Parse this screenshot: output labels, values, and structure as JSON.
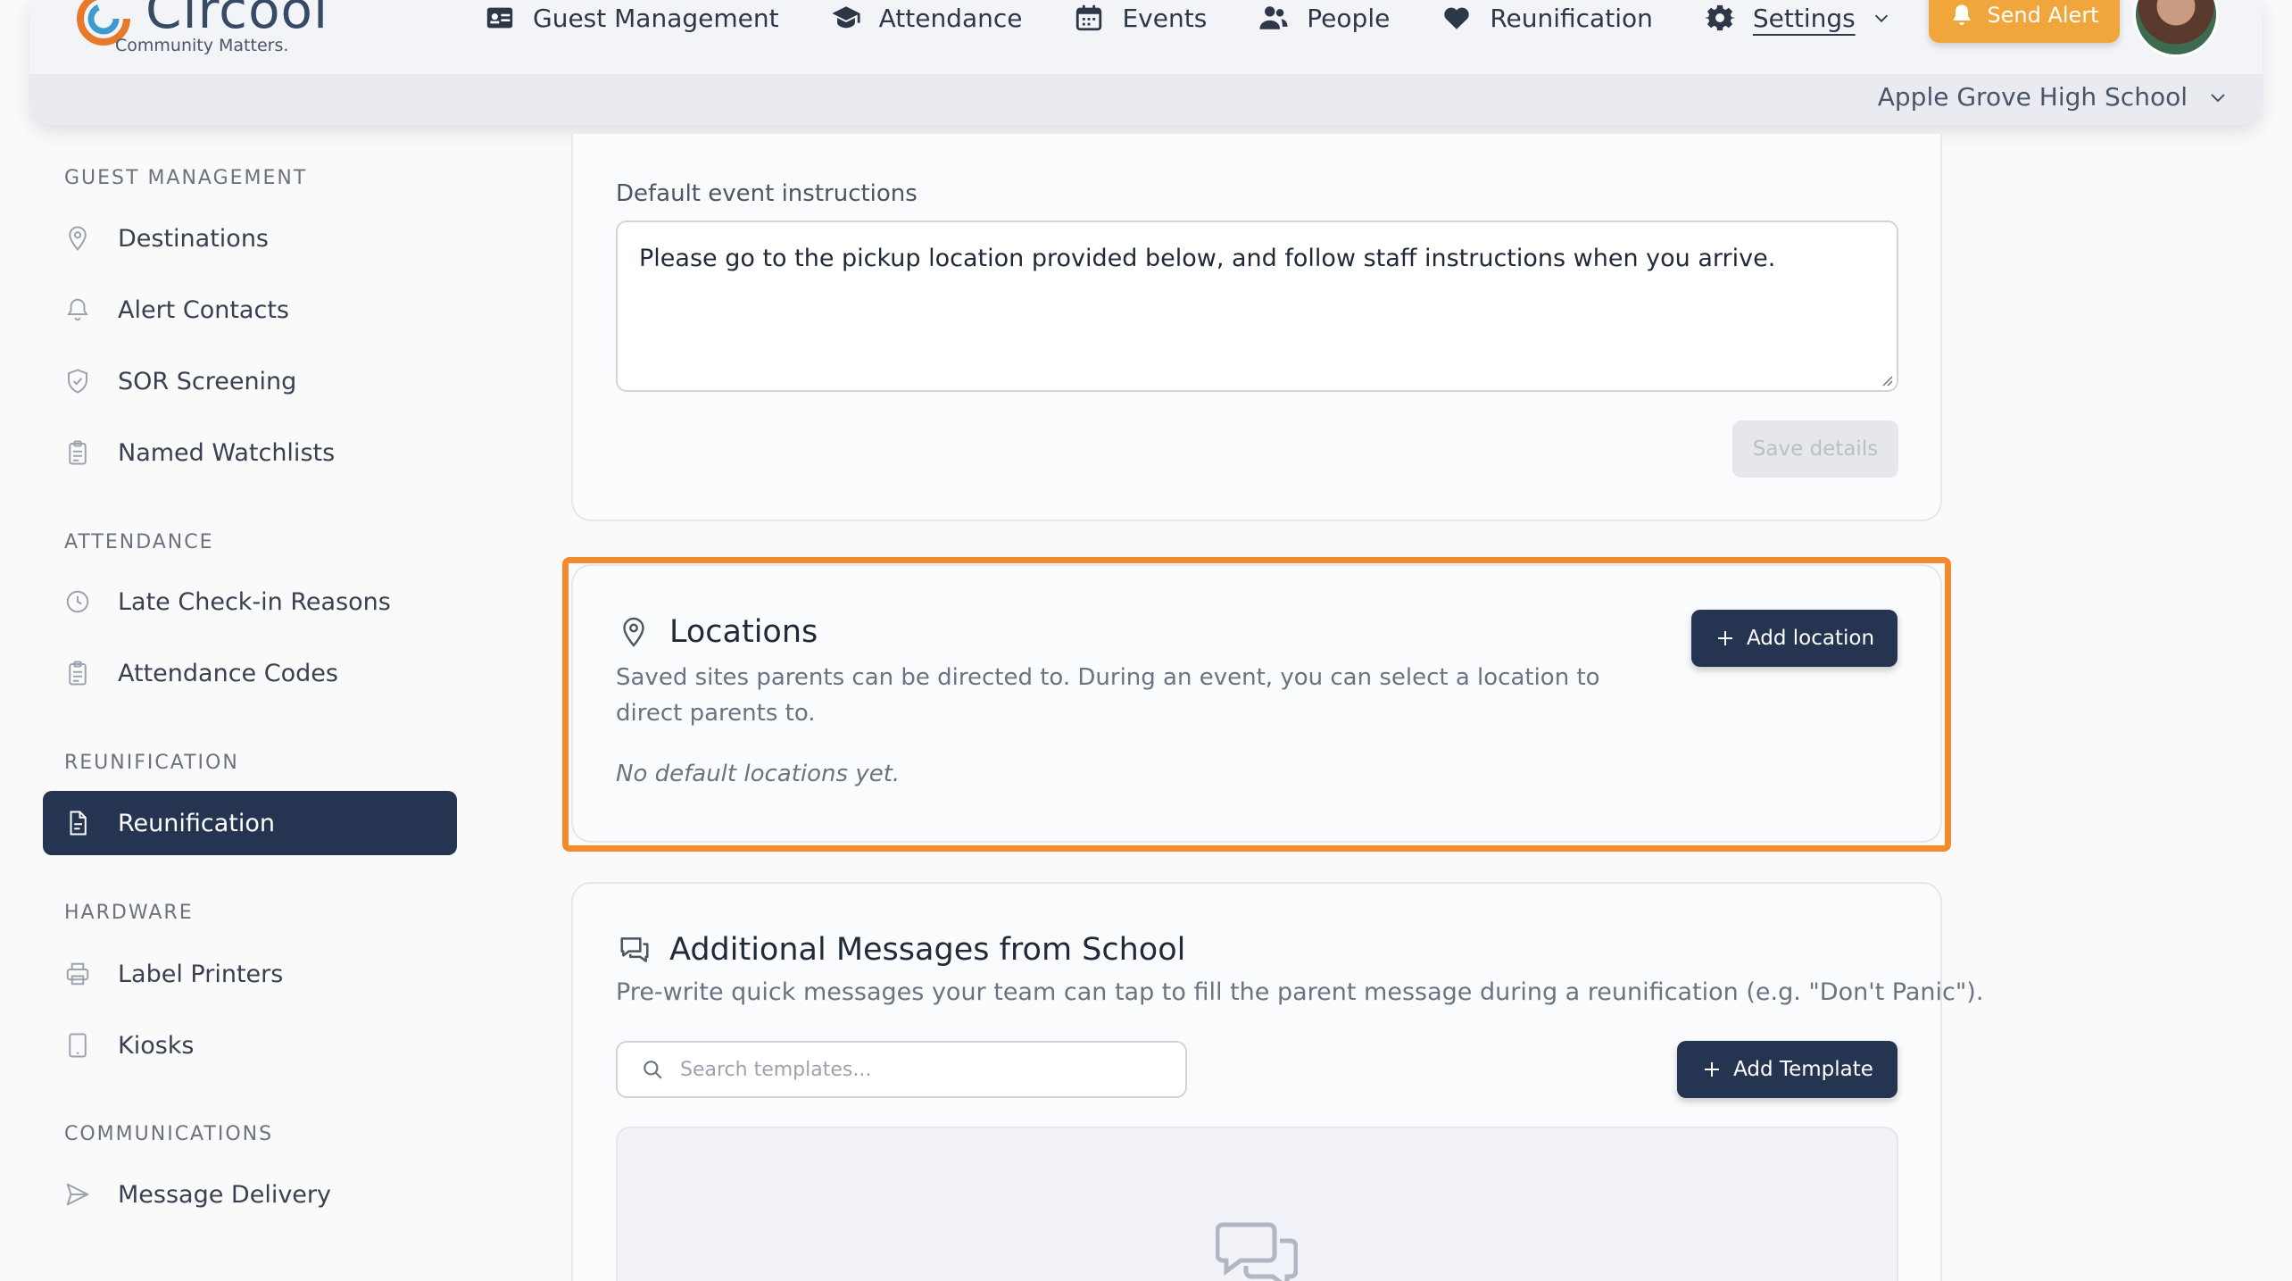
{
  "header": {
    "logo_word": "Circool",
    "logo_tagline": "Community Matters.",
    "nav": [
      {
        "label": "Guest Management",
        "icon": "id-card-icon"
      },
      {
        "label": "Attendance",
        "icon": "graduation-cap-icon"
      },
      {
        "label": "Events",
        "icon": "calendar-icon"
      },
      {
        "label": "People",
        "icon": "people-icon"
      },
      {
        "label": "Reunification",
        "icon": "heart-icon"
      },
      {
        "label": "Settings",
        "icon": "gear-icon"
      }
    ],
    "send_alert": "Send Alert",
    "school_selector": "Apple Grove High School",
    "colors": {
      "alert": "#f0a63b",
      "primary": "#243451",
      "highlight": "#f28a2e"
    }
  },
  "sidebar": {
    "sections": [
      {
        "title": "GUEST MANAGEMENT",
        "items": [
          {
            "label": "Destinations",
            "icon": "location-pin-icon"
          },
          {
            "label": "Alert Contacts",
            "icon": "bell-icon"
          },
          {
            "label": "SOR Screening",
            "icon": "shield-icon"
          },
          {
            "label": "Named Watchlists",
            "icon": "clipboard-icon"
          }
        ]
      },
      {
        "title": "ATTENDANCE",
        "items": [
          {
            "label": "Late Check-in Reasons",
            "icon": "clock-icon"
          },
          {
            "label": "Attendance Codes",
            "icon": "clipboard-icon"
          }
        ]
      },
      {
        "title": "REUNIFICATION",
        "items": [
          {
            "label": "Reunification",
            "icon": "document-icon",
            "active": true
          }
        ]
      },
      {
        "title": "HARDWARE",
        "items": [
          {
            "label": "Label Printers",
            "icon": "printer-icon"
          },
          {
            "label": "Kiosks",
            "icon": "tablet-icon"
          }
        ]
      },
      {
        "title": "COMMUNICATIONS",
        "items": [
          {
            "label": "Message Delivery",
            "icon": "send-icon"
          }
        ]
      }
    ]
  },
  "main": {
    "instructions": {
      "label": "Default event instructions",
      "value": "Please go to the pickup location provided below, and follow staff instructions when you arrive.",
      "save_label": "Save details"
    },
    "locations": {
      "title": "Locations",
      "description": "Saved sites parents can be directed to. During an event, you can select a location to direct parents to.",
      "empty": "No default locations yet.",
      "add_label": "Add location"
    },
    "messages": {
      "title": "Additional Messages from School",
      "description": "Pre-write quick messages your team can tap to fill the parent message during a reunification (e.g. \"Don't Panic\").",
      "search_placeholder": "Search templates...",
      "add_label": "Add Template"
    }
  }
}
